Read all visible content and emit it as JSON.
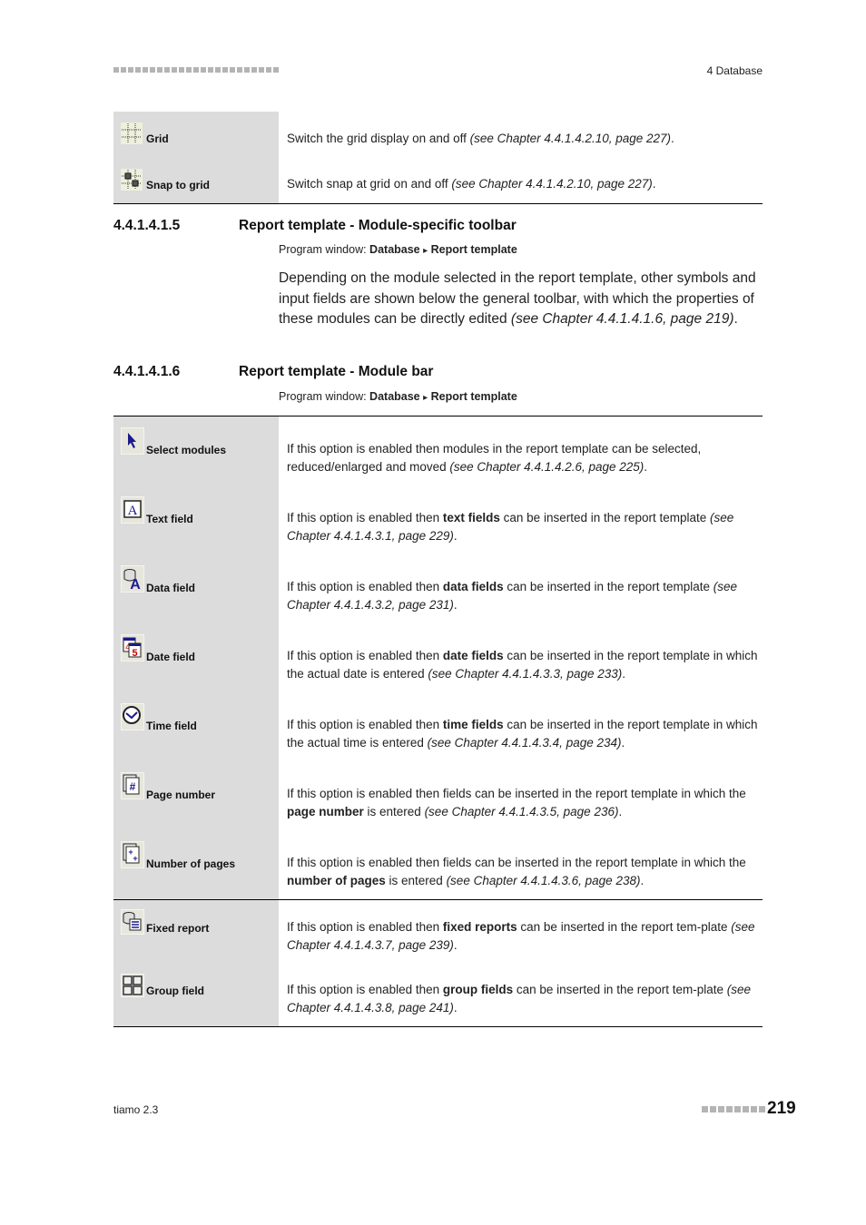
{
  "header": {
    "chapter": "4 Database"
  },
  "top_table": [
    {
      "icon": "grid-icon",
      "label": "Grid",
      "text": "Switch the grid display on and off ",
      "ref": "(see Chapter 4.4.1.4.2.10, page 227)",
      "end": "."
    },
    {
      "icon": "snap-to-grid-icon",
      "label": "Snap to grid",
      "text": "Switch snap at grid on and off ",
      "ref": "(see Chapter 4.4.1.4.2.10, page 227)",
      "end": "."
    }
  ],
  "section1": {
    "number": "4.4.1.4.1.5",
    "title": "Report template - Module-specific toolbar",
    "program_window_prefix": "Program window: ",
    "program_window_path1": "Database",
    "arrow": "▸",
    "program_window_path2": "Report template",
    "paragraph": "Depending on the module selected in the report template, other symbols and input fields are shown below the general toolbar, with which the properties of these modules can be directly edited ",
    "paragraph_ref": "(see Chapter 4.4.1.4.1.6, page 219)",
    "paragraph_end": "."
  },
  "section2": {
    "number": "4.4.1.4.1.6",
    "title": "Report template - Module bar",
    "program_window_prefix": "Program window: ",
    "program_window_path1": "Database",
    "arrow": "▸",
    "program_window_path2": "Report template"
  },
  "module_table": [
    {
      "icon": "select-arrow-icon",
      "label": "Select modules",
      "pre": "If this option is enabled then modules in the report template can be selected, reduced/enlarged and moved ",
      "bold": "",
      "post": "",
      "ref": "(see Chapter 4.4.1.4.2.6, page 225)",
      "end": "."
    },
    {
      "icon": "text-field-icon",
      "label": "Text field",
      "pre": "If this option is enabled then ",
      "bold": "text fields",
      "post": " can be inserted in the report template ",
      "ref": "(see Chapter 4.4.1.4.3.1, page 229)",
      "end": "."
    },
    {
      "icon": "data-field-icon",
      "label": "Data field",
      "pre": "If this option is enabled then ",
      "bold": "data fields",
      "post": " can be inserted in the report template ",
      "ref": "(see Chapter 4.4.1.4.3.2, page 231)",
      "end": "."
    },
    {
      "icon": "date-field-icon",
      "label": "Date field",
      "pre": "If this option is enabled then ",
      "bold": "date fields",
      "post": " can be inserted in the report template in which the actual date is entered ",
      "ref": "(see Chapter 4.4.1.4.3.3, page 233)",
      "end": "."
    },
    {
      "icon": "clock-icon",
      "label": "Time field",
      "pre": "If this option is enabled then ",
      "bold": "time fields",
      "post": " can be inserted in the report template in which the actual time is entered ",
      "ref": "(see Chapter 4.4.1.4.3.4, page 234)",
      "end": "."
    },
    {
      "icon": "page-number-icon",
      "label": "Page number",
      "pre": "If this option is enabled then fields can be inserted in the report template in which the ",
      "bold": "page number",
      "post": " is entered ",
      "ref": "(see Chapter 4.4.1.4.3.5, page 236)",
      "end": "."
    },
    {
      "icon": "number-of-pages-icon",
      "label": "Number of pages",
      "pre": "If this option is enabled then fields can be inserted in the report template in which the ",
      "bold": "number of pages",
      "post": " is entered ",
      "ref": "(see Chapter 4.4.1.4.3.6, page 238)",
      "end": "."
    }
  ],
  "module_table2": [
    {
      "icon": "fixed-report-icon",
      "label": "Fixed report",
      "pre": "If this option is enabled then ",
      "bold": "fixed reports",
      "post": " can be inserted in the report tem-plate ",
      "ref": "(see Chapter 4.4.1.4.3.7, page 239)",
      "end": "."
    },
    {
      "icon": "group-field-icon",
      "label": "Group field",
      "pre": "If this option is enabled then ",
      "bold": "group fields",
      "post": " can be inserted in the report tem-plate ",
      "ref": "(see Chapter 4.4.1.4.3.8, page 241)",
      "end": "."
    }
  ],
  "footer": {
    "product": "tiamo 2.3",
    "page_number": "219"
  }
}
